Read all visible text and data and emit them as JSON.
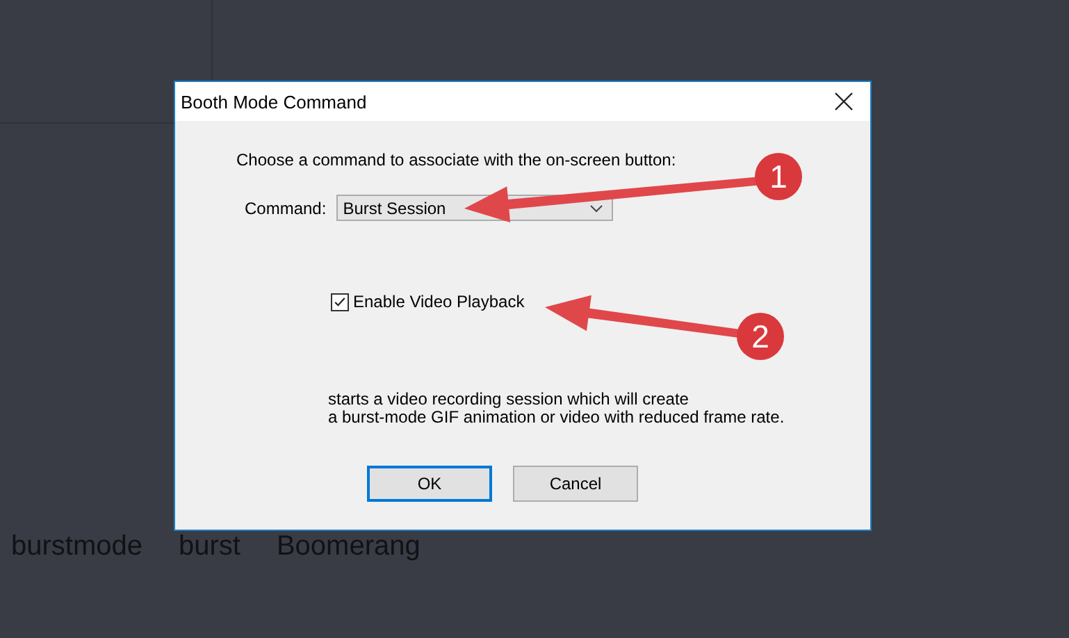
{
  "background": {
    "tags": [
      "burstmode",
      "burst",
      "Boomerang"
    ]
  },
  "dialog": {
    "title": "Booth Mode Command",
    "prompt": "Choose a command to associate with the on-screen button:",
    "command": {
      "label": "Command:",
      "value": "Burst Session"
    },
    "checkbox": {
      "label": "Enable Video Playback",
      "checked": true
    },
    "description": [
      "starts a video recording session which will create",
      "a burst-mode GIF animation or video with reduced frame rate."
    ],
    "buttons": [
      {
        "label": "OK",
        "default": true
      },
      {
        "label": "Cancel",
        "default": false
      }
    ]
  },
  "annotations": [
    {
      "number": "1"
    },
    {
      "number": "2"
    }
  ]
}
